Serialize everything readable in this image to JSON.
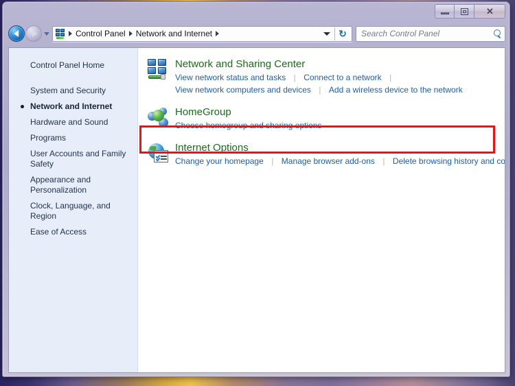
{
  "window": {
    "controls": {
      "minimize_label": "Minimize",
      "maximize_label": "Maximize",
      "close_label": "Close",
      "close_glyph": "✕"
    }
  },
  "navbar": {
    "back_label": "Back",
    "forward_label": "Forward",
    "history_label": "Recent pages",
    "breadcrumbs": [
      {
        "label": "Control Panel"
      },
      {
        "label": "Network and Internet"
      }
    ],
    "dropdown_label": "Previous locations",
    "refresh_glyph": "↻"
  },
  "search": {
    "placeholder": "Search Control Panel",
    "value": ""
  },
  "sidebar": {
    "home": {
      "label": "Control Panel Home"
    },
    "items": [
      {
        "label": "System and Security",
        "active": false
      },
      {
        "label": "Network and Internet",
        "active": true
      },
      {
        "label": "Hardware and Sound",
        "active": false
      },
      {
        "label": "Programs",
        "active": false
      },
      {
        "label": "User Accounts and Family Safety",
        "active": false
      },
      {
        "label": "Appearance and Personalization",
        "active": false
      },
      {
        "label": "Clock, Language, and Region",
        "active": false
      },
      {
        "label": "Ease of Access",
        "active": false
      }
    ]
  },
  "main": {
    "categories": [
      {
        "icon": "network-sharing-center-icon",
        "title": "Network and Sharing Center",
        "rows": [
          [
            "View network status and tasks",
            "Connect to a network"
          ],
          [
            "View network computers and devices",
            "Add a wireless device to the network"
          ]
        ]
      },
      {
        "icon": "homegroup-icon",
        "title": "HomeGroup",
        "rows": [
          [
            "Choose homegroup and sharing options"
          ]
        ]
      },
      {
        "icon": "internet-options-icon",
        "title": "Internet Options",
        "rows": [
          [
            "Change your homepage",
            "Manage browser add-ons",
            "Delete browsing history and cookies"
          ]
        ]
      }
    ]
  },
  "annotation": {
    "highlight_color": "#ee1111",
    "target": "Internet Options"
  }
}
